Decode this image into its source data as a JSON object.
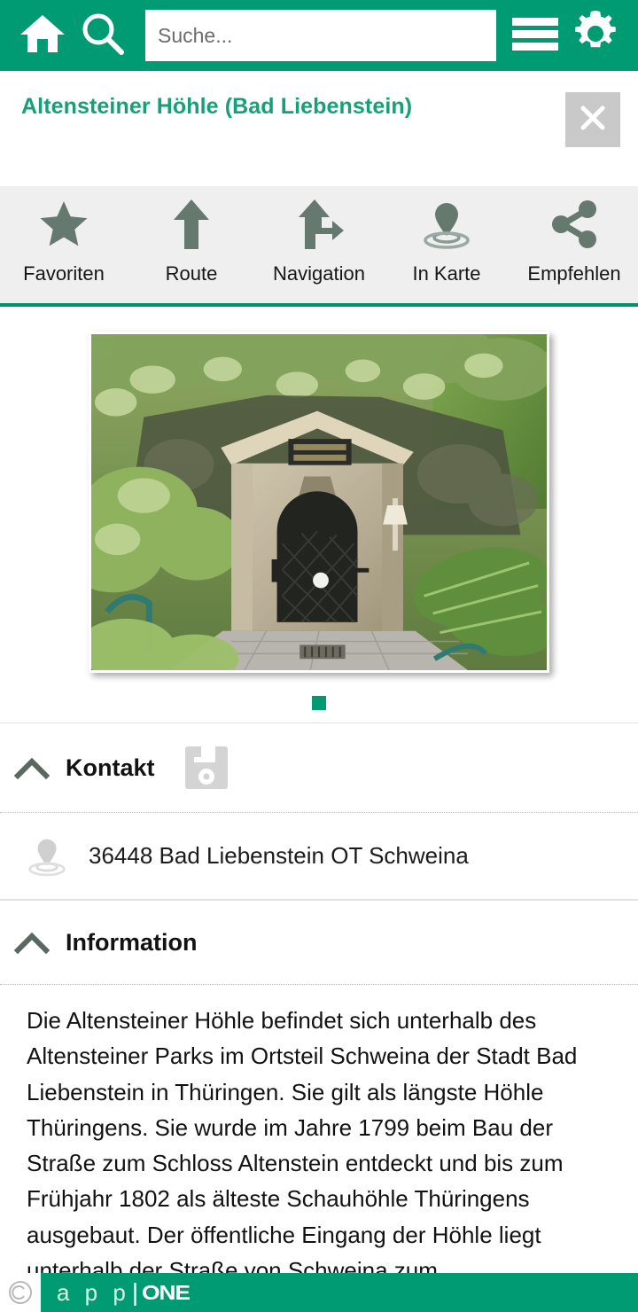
{
  "appbar": {
    "home_label": "Home",
    "search_label": "Suche",
    "search_value": "",
    "search_placeholder": "Suche...",
    "menu_label": "Menü",
    "settings_label": "Einstellungen",
    "background_color": "#009B72"
  },
  "titlebar": {
    "title": "Altensteiner Höhle (Bad Liebenstein)",
    "title_color": "#16A07A",
    "close_label": "Schließen"
  },
  "actions": [
    {
      "icon": "star-icon",
      "label": "Favoriten"
    },
    {
      "icon": "arrow-up-icon",
      "label": "Route"
    },
    {
      "icon": "navigation-fork-icon",
      "label": "Navigation"
    },
    {
      "icon": "map-pin-icon",
      "label": "In Karte"
    },
    {
      "icon": "share-icon",
      "label": "Empfehlen"
    }
  ],
  "gallery": {
    "image_alt": "Eingang der Altensteiner Höhle mit Steinportal und Eisentor",
    "page_count": 1,
    "current_page": 1,
    "dot_color": "#009B72"
  },
  "sections": [
    {
      "id": "kontakt",
      "title": "Kontakt",
      "collapse_icon": "chevron-up-icon",
      "save_icon": "save-floppy-icon",
      "rows": [
        {
          "icon": "map-pin-icon",
          "text": "36448 Bad Liebenstein OT Schweina"
        }
      ]
    },
    {
      "id": "information",
      "title": "Information",
      "collapse_icon": "chevron-up-icon",
      "body": "Die Altensteiner Höhle befindet sich unterhalb des Altensteiner Parks im Ortsteil Schweina der Stadt Bad Liebenstein in Thüringen. Sie gilt als längste Höhle Thüringens. Sie wurde im Jahre 1799 beim Bau der Straße zum Schloss Altenstein entdeckt und bis zum Frühjahr 1802 als älteste Schauhöhle Thüringens ausgebaut. Der öffentliche Eingang der Höhle liegt unterhalb der Straße von Schweina zum"
    }
  ],
  "footer": {
    "copyright_symbol": "©",
    "brand_first": "a p p",
    "brand_separator": "|",
    "brand_second": "ONE",
    "background_color": "#009B72"
  }
}
